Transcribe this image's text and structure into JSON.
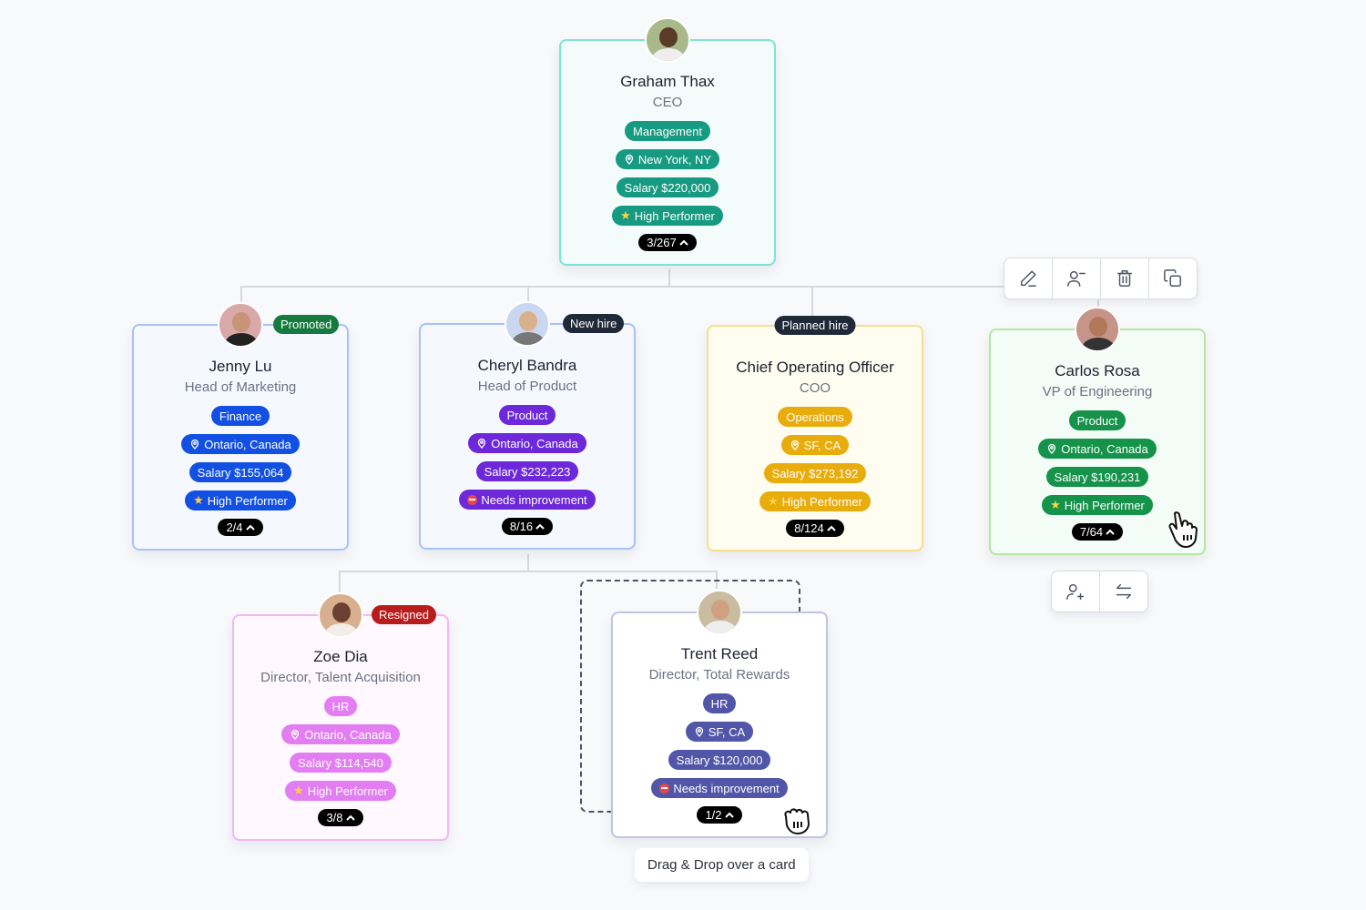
{
  "nodes": {
    "ceo": {
      "name": "Graham Thax",
      "title": "CEO",
      "colors": {
        "border": "#7fe3d2",
        "bg": "#f3fcfa",
        "chip": "#179a82"
      },
      "department": "Management",
      "location": "New York, NY",
      "salary": "Salary $220,000",
      "performance": "High Performer",
      "performance_icon": "star",
      "count": "3/267"
    },
    "jenny": {
      "name": "Jenny Lu",
      "title": "Head of Marketing",
      "status": "Promoted",
      "status_color": "#157a3e",
      "colors": {
        "border": "#a9c2f5",
        "bg": "#f5f8ff",
        "chip": "#1250e3"
      },
      "department": "Finance",
      "location": "Ontario, Canada",
      "salary": "Salary $155,064",
      "performance": "High Performer",
      "performance_icon": "star",
      "count": "2/4"
    },
    "cheryl": {
      "name": "Cheryl Bandra",
      "title": "Head of Product",
      "status": "New hire",
      "status_color": "#1f2937",
      "colors": {
        "border": "#a9c2f5",
        "bg": "#f5f8ff",
        "chip": "#6d28d9"
      },
      "department": "Product",
      "location": "Ontario, Canada",
      "salary": "Salary $232,223",
      "performance": "Needs improvement",
      "performance_icon": "no-entry",
      "count": "8/16"
    },
    "coo": {
      "name": "Chief Operating Officer",
      "title": "COO",
      "status": "Planned hire",
      "status_color": "#1f2937",
      "colors": {
        "border": "#f6df8c",
        "bg": "#fffdf0",
        "chip": "#e8ac0c"
      },
      "department": "Operations",
      "location": "SF, CA",
      "salary": "Salary $273,192",
      "performance": "High Performer",
      "performance_icon": "star",
      "count": "8/124"
    },
    "carlos": {
      "name": "Carlos Rosa",
      "title": "VP of Engineering",
      "colors": {
        "border": "#b5e8a0",
        "bg": "#f3fcf6",
        "chip": "#15934a"
      },
      "department": "Product",
      "location": "Ontario, Canada",
      "salary": "Salary $190,231",
      "performance": "High Performer",
      "performance_icon": "star",
      "count": "7/64"
    },
    "zoe": {
      "name": "Zoe Dia",
      "title": "Director, Talent Acquisition",
      "status": "Resigned",
      "status_color": "#b91c1c",
      "colors": {
        "border": "#f0b8f5",
        "bg": "#fff8ff",
        "chip": "#e27ef2"
      },
      "department": "HR",
      "location": "Ontario, Canada",
      "salary": "Salary $114,540",
      "performance": "High Performer",
      "performance_icon": "star",
      "count": "3/8"
    },
    "trent": {
      "name": "Trent Reed",
      "title": "Director, Total Rewards",
      "colors": {
        "border": "#c0c4e0",
        "bg": "#ffffff",
        "chip": "#5156a8"
      },
      "department": "HR",
      "location": "SF, CA",
      "salary": "Salary $120,000",
      "performance": "Needs improvement",
      "performance_icon": "no-entry",
      "count": "1/2"
    }
  },
  "toolbar": {
    "actions": [
      "edit",
      "remove-manager",
      "delete",
      "duplicate"
    ]
  },
  "sub_toolbar": {
    "actions": [
      "add-report",
      "swap"
    ]
  },
  "tooltip": "Drag & Drop over a card"
}
